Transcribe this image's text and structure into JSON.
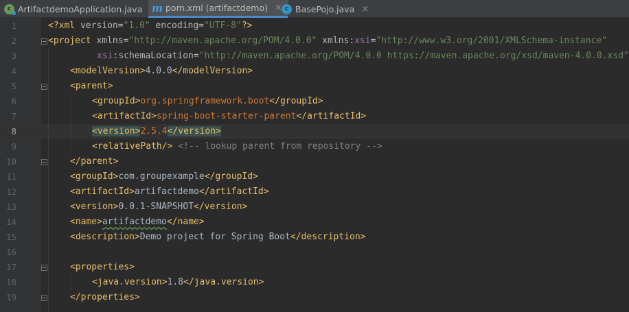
{
  "tabs": [
    {
      "label": "ArtifactdemoApplication.java",
      "icon": "spring-class-icon",
      "active": false
    },
    {
      "label": "pom.xml (artifactdemo)",
      "icon": "maven-icon",
      "active": true
    },
    {
      "label": "BasePojo.java",
      "icon": "class-icon",
      "active": false
    }
  ],
  "close_glyph": "×",
  "editor": {
    "current_line": 8,
    "line_numbers": [
      "1",
      "2",
      "3",
      "4",
      "5",
      "6",
      "7",
      "8",
      "9",
      "10",
      "11",
      "12",
      "13",
      "14",
      "15",
      "16",
      "17",
      "18",
      "19"
    ],
    "lines": {
      "l1": {
        "open": "<?",
        "tag": "xml",
        "attr1": " version=",
        "val1": "\"1.0\"",
        "attr2": " encoding=",
        "val2": "\"UTF-8\"",
        "close": "?>"
      },
      "l2": {
        "open": "<",
        "tag": "project",
        "attr1": " xmlns=",
        "val1": "\"http://maven.apache.org/POM/4.0.0\"",
        "ns1": " xmlns",
        "colon1": ":",
        "nsattr1": "xsi",
        "eq": "=",
        "val2": "\"http://www.w3.org/2001/XMLSchema-instance\""
      },
      "l3": {
        "ns": "xsi",
        "colon": ":",
        "attr": "schemaLocation=",
        "val": "\"http://maven.apache.org/POM/4.0.0 https://maven.apache.org/xsd/maven-4.0.0.xsd\"",
        "close": ">"
      },
      "l4": {
        "open": "<modelVersion>",
        "text": "4.0.0",
        "close": "</modelVersion>"
      },
      "l5": {
        "open": "<parent>"
      },
      "l6": {
        "open": "<groupId>",
        "text": "org.springframework.boot",
        "close": "</groupId>"
      },
      "l7": {
        "open": "<artifactId>",
        "text": "spring-boot-starter-parent",
        "close": "</artifactId>"
      },
      "l8": {
        "open": "<version>",
        "text": "2.5.4",
        "close": "</version>"
      },
      "l9": {
        "open": "<relativePath/>",
        "comment": " <!-- lookup parent from repository -->"
      },
      "l10": {
        "close": "</parent>"
      },
      "l11": {
        "open": "<groupId>",
        "text": "com.groupexample",
        "close": "</groupId>"
      },
      "l12": {
        "open": "<artifactId>",
        "text": "artifactdemo",
        "close": "</artifactId>"
      },
      "l13": {
        "open": "<version>",
        "text": "0.0.1-SNAPSHOT",
        "close": "</version>"
      },
      "l14": {
        "open": "<name>",
        "text": "artifactdemo",
        "close": "</name>"
      },
      "l15": {
        "open": "<description>",
        "text": "Demo project for Spring Boot",
        "close": "</description>"
      },
      "l17": {
        "open": "<properties>"
      },
      "l18": {
        "open": "<java.version>",
        "text": "1.8",
        "close": "</java.version>"
      },
      "l19": {
        "close": "</properties>"
      }
    }
  }
}
